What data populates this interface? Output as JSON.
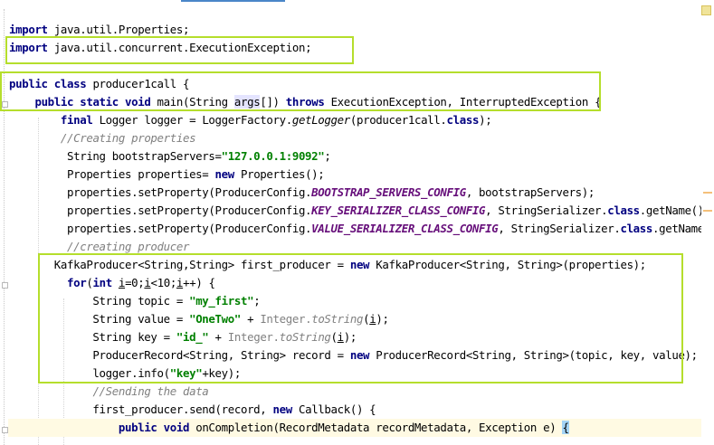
{
  "editor": {
    "lines": [
      [
        {
          "c": "kw",
          "t": "import"
        },
        {
          "t": " java.util.Properties;"
        }
      ],
      [
        {
          "c": "kw",
          "t": "import"
        },
        {
          "t": " java.util.concurrent.ExecutionException;"
        }
      ],
      [],
      [
        {
          "c": "kw",
          "t": "public class"
        },
        {
          "t": " producer1call {"
        }
      ],
      [
        {
          "t": "    "
        },
        {
          "c": "kw",
          "t": "public static void"
        },
        {
          "t": " main(String "
        },
        {
          "c": "arg",
          "t": "args"
        },
        {
          "t": "[]) "
        },
        {
          "c": "kw",
          "t": "throws"
        },
        {
          "t": " ExecutionException, InterruptedException {"
        }
      ],
      [
        {
          "t": "        "
        },
        {
          "c": "kw",
          "t": "final"
        },
        {
          "t": " Logger logger = LoggerFactory."
        },
        {
          "c": "mth",
          "t": "getLogger"
        },
        {
          "t": "(producer1call."
        },
        {
          "c": "kw",
          "t": "class"
        },
        {
          "t": ");"
        }
      ],
      [
        {
          "t": "        "
        },
        {
          "c": "cmt",
          "t": "//Creating properties"
        }
      ],
      [
        {
          "t": "         String bootstrapServers="
        },
        {
          "c": "str",
          "t": "\"127.0.0.1:9092\""
        },
        {
          "t": ";"
        }
      ],
      [
        {
          "t": "         Properties properties= "
        },
        {
          "c": "kw",
          "t": "new"
        },
        {
          "t": " Properties();"
        }
      ],
      [
        {
          "t": "         properties.setProperty(ProducerConfig."
        },
        {
          "c": "cst",
          "t": "BOOTSTRAP_SERVERS_CONFIG"
        },
        {
          "t": ", bootstrapServers);"
        }
      ],
      [
        {
          "t": "         properties.setProperty(ProducerConfig."
        },
        {
          "c": "cst",
          "t": "KEY_SERIALIZER_CLASS_CONFIG"
        },
        {
          "t": ", StringSerializer."
        },
        {
          "c": "kw",
          "t": "class"
        },
        {
          "t": ".getName());"
        }
      ],
      [
        {
          "t": "         properties.setProperty(ProducerConfig."
        },
        {
          "c": "cst",
          "t": "VALUE_SERIALIZER_CLASS_CONFIG"
        },
        {
          "t": ", StringSerializer."
        },
        {
          "c": "kw",
          "t": "class"
        },
        {
          "t": ".getName());"
        }
      ],
      [
        {
          "t": "         "
        },
        {
          "c": "cmt",
          "t": "//creating producer"
        }
      ],
      [
        {
          "t": "       KafkaProducer<String,String> first_producer = "
        },
        {
          "c": "kw",
          "t": "new"
        },
        {
          "t": " KafkaProducer<String, String>(properties);"
        }
      ],
      [
        {
          "t": "         "
        },
        {
          "c": "kw",
          "t": "for"
        },
        {
          "t": "("
        },
        {
          "c": "kw",
          "t": "int"
        },
        {
          "t": " "
        },
        {
          "c": "ul",
          "t": "i"
        },
        {
          "t": "=0;"
        },
        {
          "c": "ul",
          "t": "i"
        },
        {
          "t": "<10;"
        },
        {
          "c": "ul",
          "t": "i"
        },
        {
          "t": "++) {"
        }
      ],
      [
        {
          "t": "             String topic = "
        },
        {
          "c": "str",
          "t": "\"my_first\""
        },
        {
          "t": ";"
        }
      ],
      [
        {
          "t": "             String value = "
        },
        {
          "c": "str",
          "t": "\"OneTwo\""
        },
        {
          "t": " + "
        },
        {
          "c": "gry",
          "t": "Integer."
        },
        {
          "c": "gry mth",
          "t": "toString"
        },
        {
          "t": "("
        },
        {
          "c": "ul",
          "t": "i"
        },
        {
          "t": ");"
        }
      ],
      [
        {
          "t": "             String key = "
        },
        {
          "c": "str",
          "t": "\"id_\""
        },
        {
          "t": " + "
        },
        {
          "c": "gry",
          "t": "Integer."
        },
        {
          "c": "gry mth",
          "t": "toString"
        },
        {
          "t": "("
        },
        {
          "c": "ul",
          "t": "i"
        },
        {
          "t": ");"
        }
      ],
      [
        {
          "t": "             ProducerRecord<String, String> record = "
        },
        {
          "c": "kw",
          "t": "new"
        },
        {
          "t": " ProducerRecord<String, String>(topic, key, value);"
        }
      ],
      [
        {
          "t": "             logger.info("
        },
        {
          "c": "str",
          "t": "\"key\""
        },
        {
          "t": "+key);"
        }
      ],
      [
        {
          "t": "             "
        },
        {
          "c": "cmt",
          "t": "//Sending the data"
        }
      ],
      [
        {
          "t": "             first_producer.send(record, "
        },
        {
          "c": "kw",
          "t": "new"
        },
        {
          "t": " Callback() {"
        }
      ],
      [
        {
          "t": "                 "
        },
        {
          "c": "kw",
          "t": "public void"
        },
        {
          "t": " onCompletion(RecordMetadata recordMetadata, Exception e) "
        },
        {
          "c": "caret-brace",
          "t": "{"
        }
      ]
    ],
    "current_line_index": 22
  },
  "colors": {
    "highlight_box": "#b5de2c",
    "keyword": "#000080",
    "string": "#008000",
    "comment": "#808080",
    "constant": "#660e7a"
  }
}
